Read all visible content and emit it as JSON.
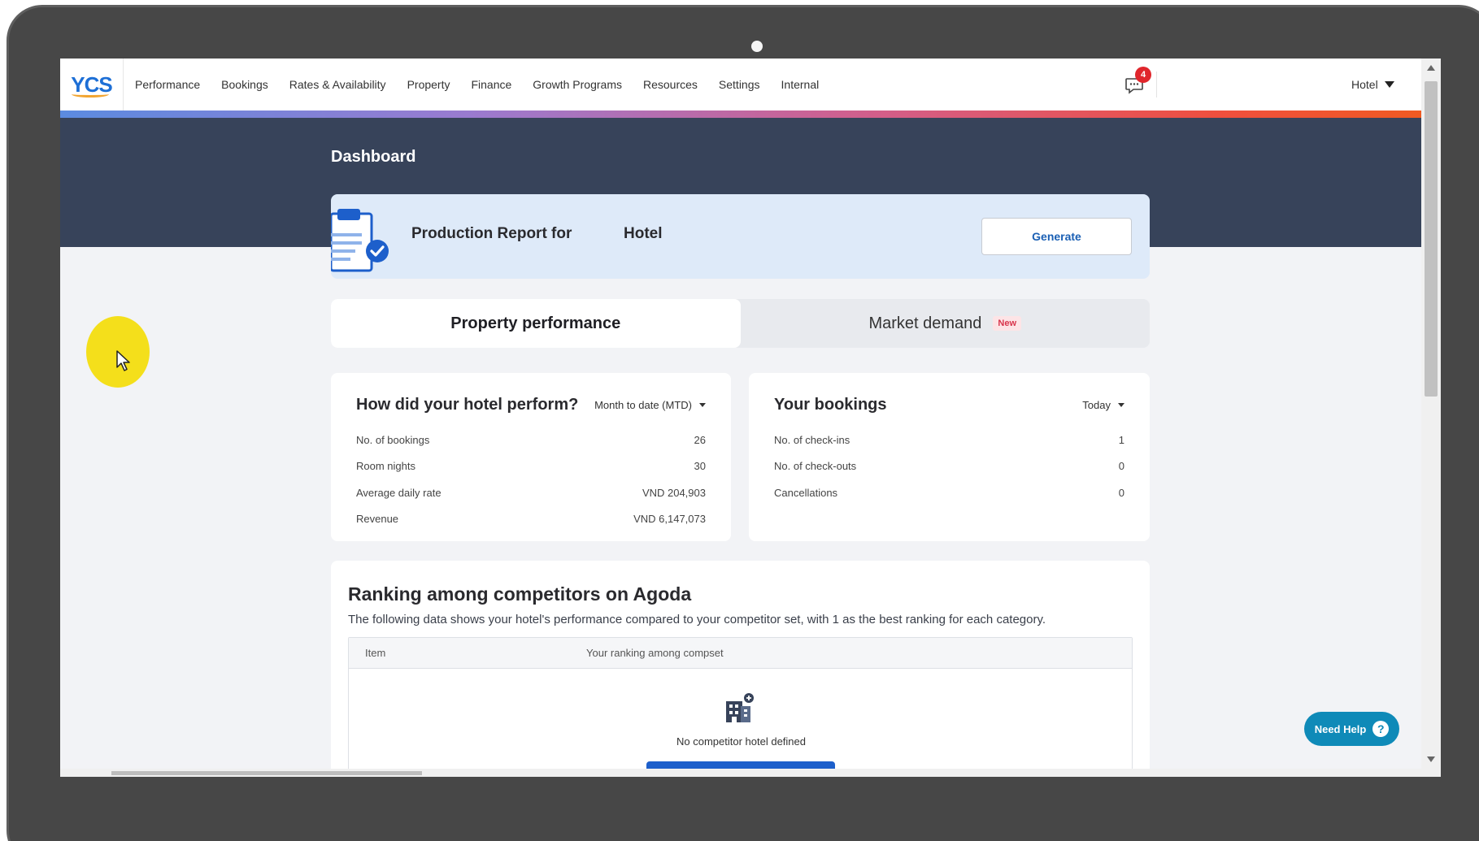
{
  "nav": {
    "logo": "YCS",
    "items": [
      {
        "label": "Performance"
      },
      {
        "label": "Bookings"
      },
      {
        "label": "Rates & Availability"
      },
      {
        "label": "Property"
      },
      {
        "label": "Finance"
      },
      {
        "label": "Growth Programs"
      },
      {
        "label": "Resources"
      },
      {
        "label": "Settings"
      },
      {
        "label": "Internal"
      }
    ],
    "notification_count": "4",
    "property_select": "Hotel"
  },
  "page": {
    "title": "Dashboard"
  },
  "report": {
    "label": "Production Report for",
    "hotel": "Hotel",
    "button": "Generate"
  },
  "tabs": {
    "property_performance": "Property performance",
    "market_demand": "Market demand",
    "new_tag": "New"
  },
  "performance": {
    "title": "How did your hotel perform?",
    "period": "Month to date (MTD)",
    "rows": [
      {
        "label": "No. of bookings",
        "value": "26"
      },
      {
        "label": "Room nights",
        "value": "30"
      },
      {
        "label": "Average daily rate",
        "value": "VND 204,903"
      },
      {
        "label": "Revenue",
        "value": "VND 6,147,073"
      }
    ]
  },
  "bookings": {
    "title": "Your bookings",
    "period": "Today",
    "rows": [
      {
        "label": "No. of check-ins",
        "value": "1"
      },
      {
        "label": "No. of check-outs",
        "value": "0"
      },
      {
        "label": "Cancellations",
        "value": "0"
      }
    ]
  },
  "ranking": {
    "title": "Ranking among competitors on Agoda",
    "description": "The following data shows your hotel's performance compared to your competitor set, with 1 as the best ranking for each category.",
    "columns": [
      "Item",
      "Your ranking among compset"
    ],
    "empty_text": "No competitor hotel defined"
  },
  "help": {
    "label": "Need Help",
    "icon": "?"
  },
  "colors": {
    "brand_blue": "#1d6fd6",
    "banner": "#37435a",
    "report_bg": "#deeaf9",
    "help_bg": "#0f8ab8",
    "badge": "#e0262c",
    "cursor_highlight": "#f4df1b"
  }
}
